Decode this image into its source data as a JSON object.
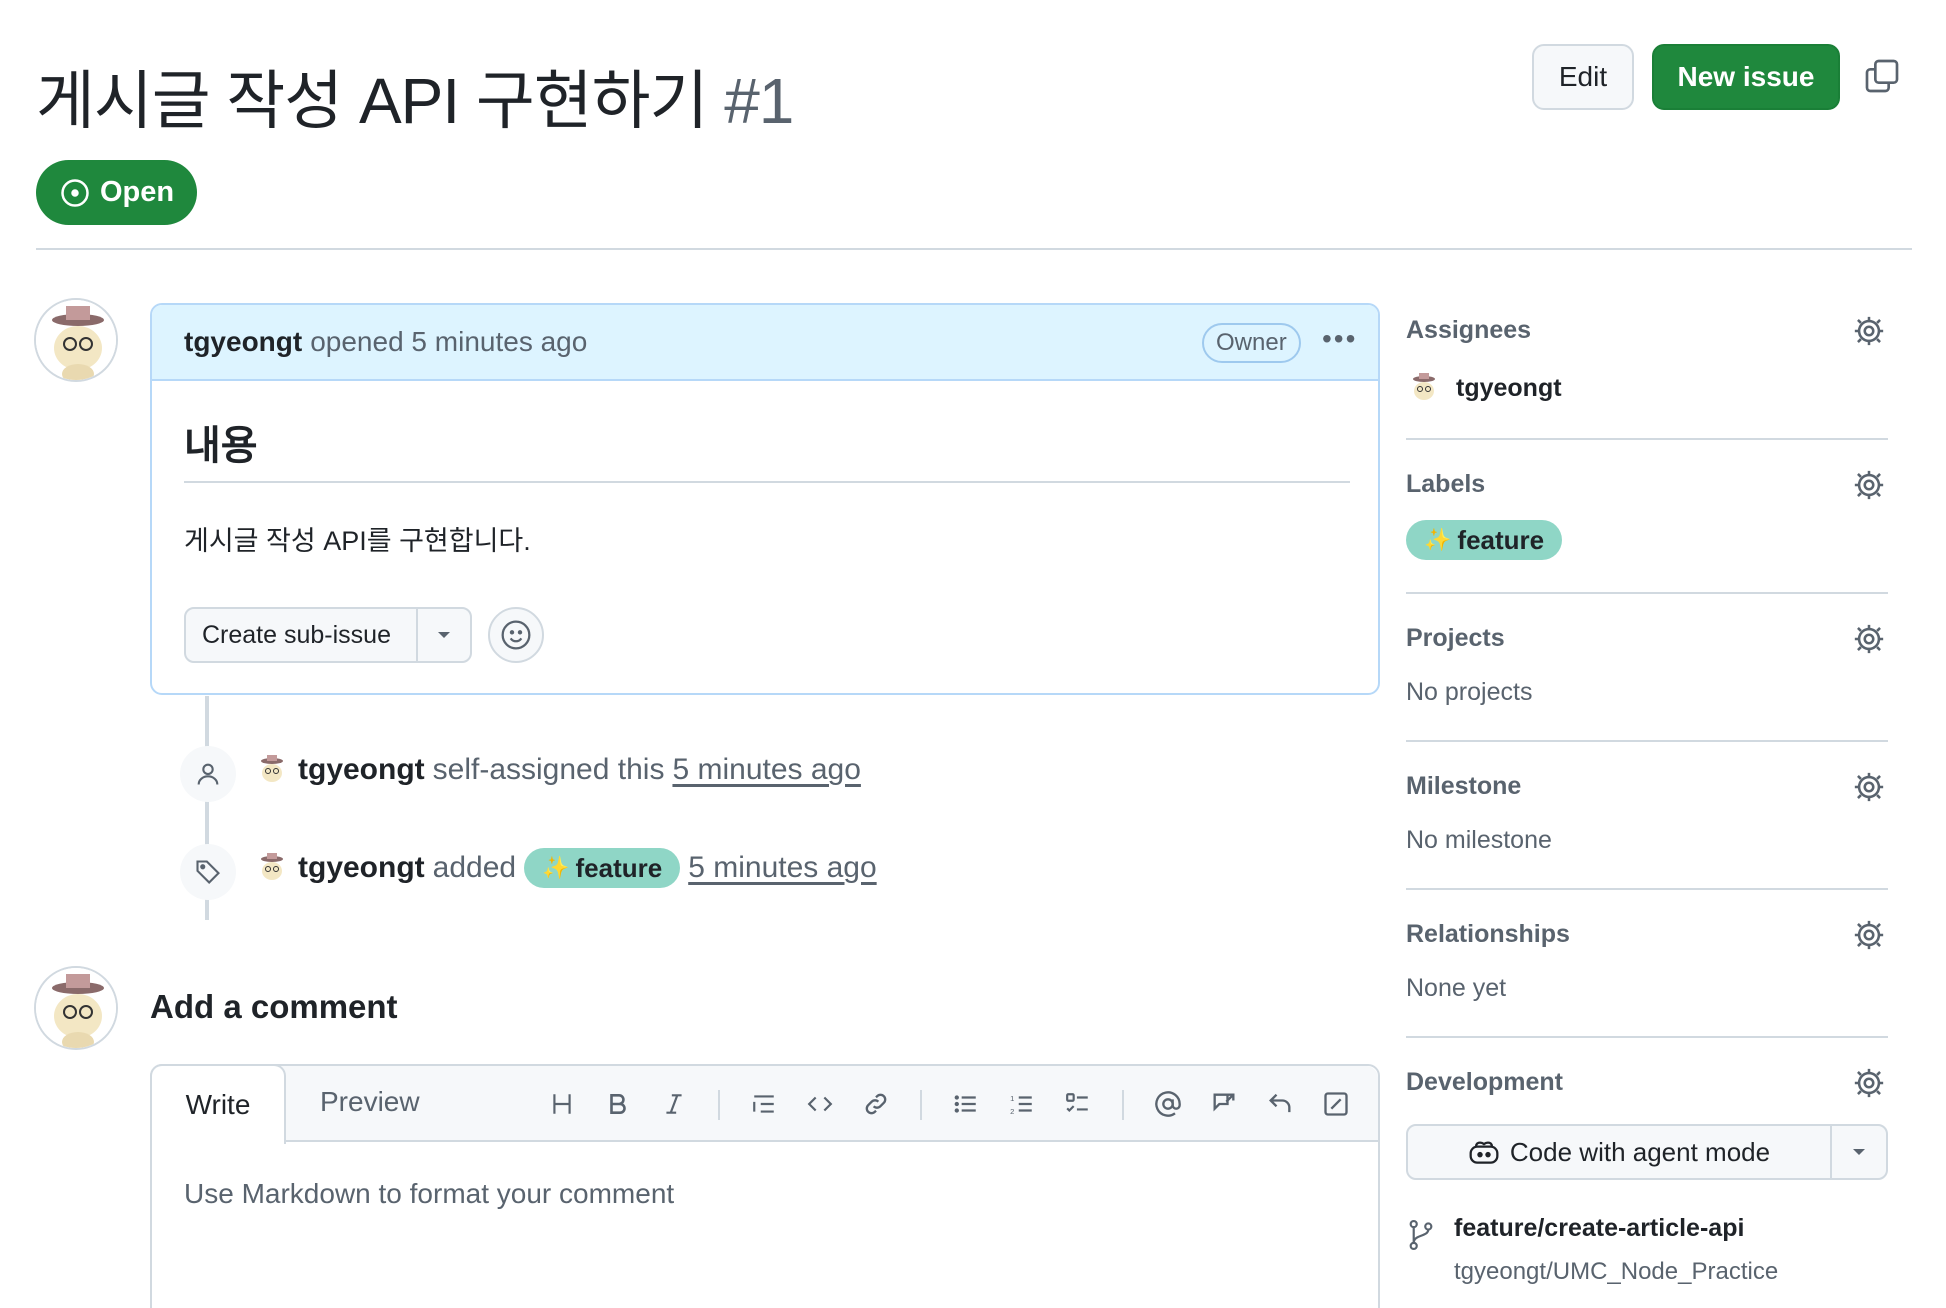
{
  "issue": {
    "title": "게시글 작성 API 구현하기",
    "number": "#1",
    "state": "Open",
    "edit_label": "Edit",
    "new_issue_label": "New issue"
  },
  "comment": {
    "author": "tgyeongt",
    "meta": "opened 5 minutes ago",
    "role_badge": "Owner",
    "more": "•••",
    "heading": "내용",
    "body": "게시글 작성 API를 구현합니다.",
    "create_sub_issue": "Create sub-issue"
  },
  "timeline": [
    {
      "user": "tgyeongt",
      "action": "self-assigned this",
      "when": "5 minutes ago"
    },
    {
      "user": "tgyeongt",
      "action": "added",
      "label": "feature",
      "when": "5 minutes ago"
    }
  ],
  "add_comment": {
    "title": "Add a comment",
    "tab_write": "Write",
    "tab_preview": "Preview",
    "placeholder": "Use Markdown to format your comment"
  },
  "sidebar": {
    "assignees": {
      "heading": "Assignees",
      "user": "tgyeongt"
    },
    "labels": {
      "heading": "Labels",
      "label": "feature",
      "label_color": "#8fd6c6"
    },
    "projects": {
      "heading": "Projects",
      "value": "No projects"
    },
    "milestone": {
      "heading": "Milestone",
      "value": "No milestone"
    },
    "relationships": {
      "heading": "Relationships",
      "value": "None yet"
    },
    "development": {
      "heading": "Development",
      "agent_button": "Code with agent mode",
      "branch": "feature/create-article-api",
      "repo": "tgyeongt/UMC_Node_Practice"
    }
  },
  "colors": {
    "accent_green": "#1f883d",
    "comment_header_bg": "#ddf4ff",
    "label_bg": "#8fd6c6"
  }
}
